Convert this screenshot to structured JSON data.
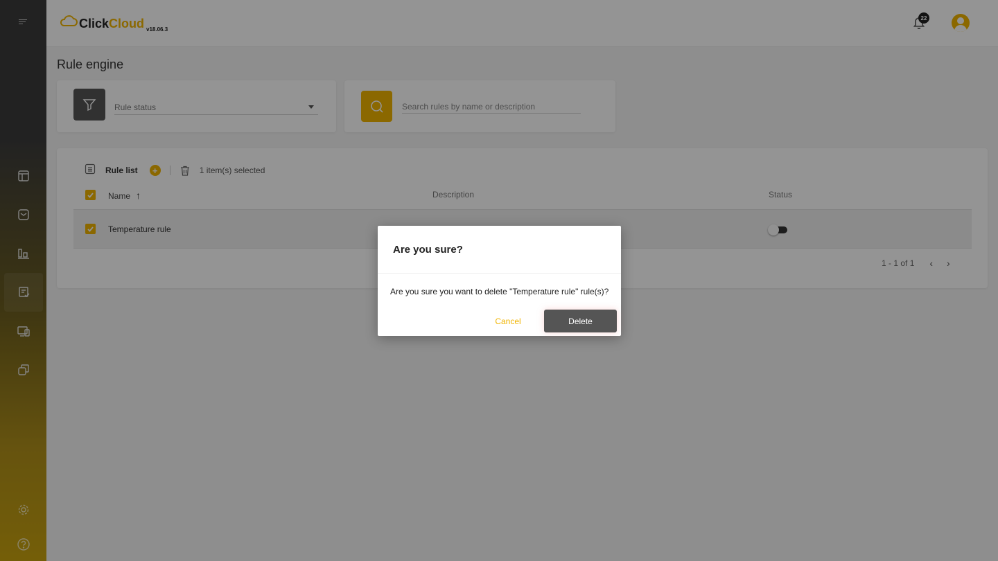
{
  "app": {
    "brand_click": "Click",
    "brand_cloud": "Cloud",
    "version": "v18.06.3",
    "notification_count": "22"
  },
  "page": {
    "title": "Rule engine"
  },
  "filter": {
    "status_label": "Rule status"
  },
  "search": {
    "placeholder": "Search rules by name or description"
  },
  "table": {
    "title": "Rule list",
    "add_symbol": "+",
    "selected_text": "1 item(s) selected",
    "columns": {
      "name": "Name",
      "description": "Description",
      "status": "Status"
    },
    "sort_arrow": "↑",
    "rows": [
      {
        "name": "Temperature rule",
        "description": "",
        "status_on": false,
        "checked": true
      }
    ],
    "pager": {
      "range": "1 - 1 of 1",
      "prev": "‹",
      "next": "›"
    }
  },
  "dialog": {
    "title": "Are you sure?",
    "message": "Are you sure you want to delete \"Temperature rule\" rule(s)?",
    "cancel_label": "Cancel",
    "delete_label": "Delete"
  },
  "colors": {
    "accent": "#f0b400",
    "dark": "#555555",
    "sidebar_top": "#3c3c3c",
    "sidebar_bottom": "#c9a30f"
  },
  "icons": {
    "sidebar": [
      "dashboard-icon",
      "inbox-icon",
      "analytics-icon",
      "rules-icon",
      "devices-icon",
      "copy-icon"
    ],
    "sidebar_bottom": [
      "settings-icon",
      "help-icon"
    ]
  }
}
